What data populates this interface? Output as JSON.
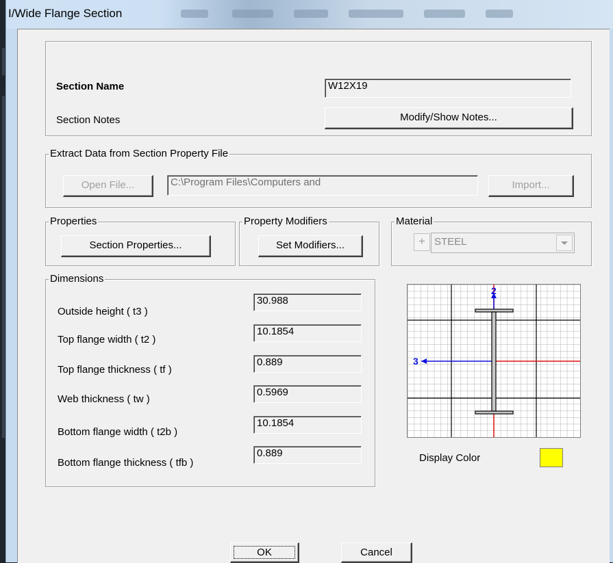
{
  "window": {
    "title": "I/Wide Flange Section"
  },
  "section": {
    "name_label": "Section Name",
    "name_value": "W12X19",
    "notes_label": "Section Notes",
    "notes_button": "Modify/Show Notes..."
  },
  "extract": {
    "title": "Extract Data from Section Property File",
    "open_button": "Open File...",
    "path_value": "C:\\Program Files\\Computers and",
    "import_button": "Import..."
  },
  "properties": {
    "title": "Properties",
    "button": "Section Properties..."
  },
  "modifiers": {
    "title": "Property Modifiers",
    "button": "Set Modifiers..."
  },
  "material": {
    "title": "Material",
    "plus": "+",
    "selected": "STEEL"
  },
  "dimensions": {
    "title": "Dimensions",
    "rows": [
      {
        "label": "Outside height  ( t3 )",
        "value": "30.988"
      },
      {
        "label": "Top flange width  ( t2 )",
        "value": "10.1854"
      },
      {
        "label": "Top flange thickness  ( tf )",
        "value": "0.889"
      },
      {
        "label": "Web thickness  ( tw )",
        "value": "0.5969"
      },
      {
        "label": "Bottom flange width  ( t2b )",
        "value": "10.1854"
      },
      {
        "label": "Bottom flange thickness  ( tfb )",
        "value": "0.889"
      }
    ]
  },
  "preview": {
    "axis_2": "2",
    "axis_3": "3"
  },
  "display_color": {
    "label": "Display Color",
    "color": "#ffff00"
  },
  "buttons": {
    "ok": "OK",
    "cancel": "Cancel"
  }
}
